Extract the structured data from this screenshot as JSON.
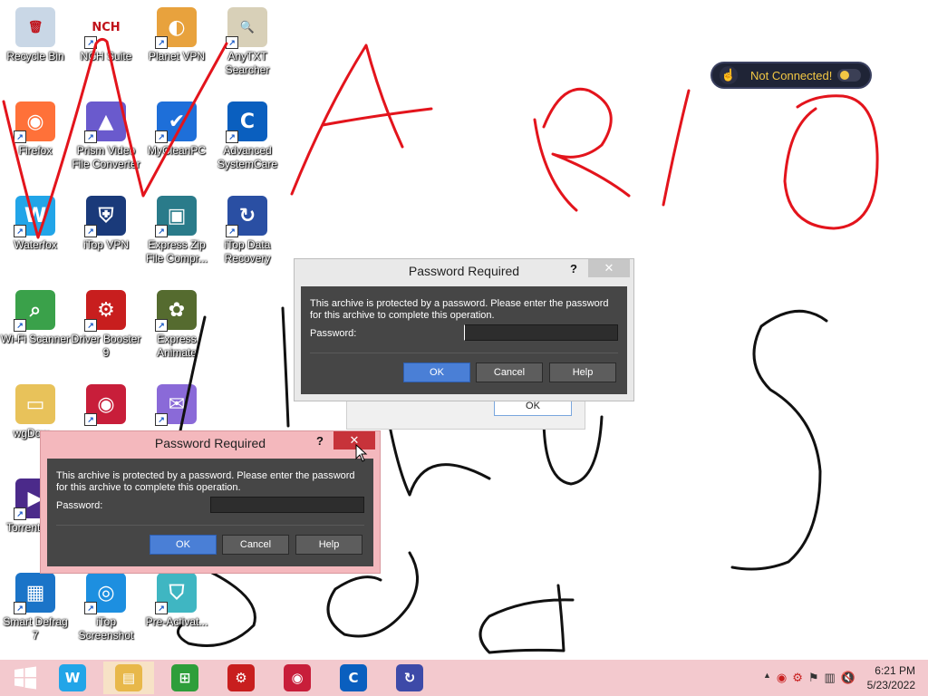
{
  "desktop_icons": [
    {
      "label": "Recycle Bin",
      "icon": "recycle-bin-icon",
      "color": "#c9d7e6",
      "glyph": "🗑",
      "shortcut": false
    },
    {
      "label": "NCH Suite",
      "icon": "nch-suite-icon",
      "color": "#ffffff",
      "glyph": "NCH",
      "shortcut": true
    },
    {
      "label": "Planet VPN",
      "icon": "planet-vpn-icon",
      "color": "#e8a23d",
      "glyph": "◐",
      "shortcut": true
    },
    {
      "label": "AnyTXT Searcher",
      "icon": "anytxt-searcher-icon",
      "color": "#d8d0b8",
      "glyph": "🔍",
      "shortcut": true
    },
    {
      "label": "Firefox",
      "icon": "firefox-icon",
      "color": "#ff7139",
      "glyph": "◉",
      "shortcut": true
    },
    {
      "label": "Prism Video File Converter",
      "icon": "prism-video-converter-icon",
      "color": "#6a5acd",
      "glyph": "▲",
      "shortcut": true
    },
    {
      "label": "MyCleanPC",
      "icon": "mycleanpc-icon",
      "color": "#1e6fd9",
      "glyph": "✔",
      "shortcut": true
    },
    {
      "label": "Advanced SystemCare",
      "icon": "advanced-systemcare-icon",
      "color": "#0a5fbf",
      "glyph": "C",
      "shortcut": true
    },
    {
      "label": "Waterfox",
      "icon": "waterfox-icon",
      "color": "#22a5e8",
      "glyph": "W",
      "shortcut": true
    },
    {
      "label": "iTop VPN",
      "icon": "itop-vpn-icon",
      "color": "#1a3a7a",
      "glyph": "⛨",
      "shortcut": true
    },
    {
      "label": "Express Zip File Compr...",
      "icon": "express-zip-icon",
      "color": "#2a7b8a",
      "glyph": "▣",
      "shortcut": true
    },
    {
      "label": "iTop Data Recovery",
      "icon": "itop-data-recovery-icon",
      "color": "#2a4fa3",
      "glyph": "↻",
      "shortcut": true
    },
    {
      "label": "Wi-Fi Scanner",
      "icon": "wifi-scanner-icon",
      "color": "#3aa14a",
      "glyph": "⌕",
      "shortcut": true
    },
    {
      "label": "Driver Booster 9",
      "icon": "driver-booster-icon",
      "color": "#c81e1e",
      "glyph": "⚙",
      "shortcut": true
    },
    {
      "label": "Express Animate",
      "icon": "express-animate-icon",
      "color": "#556b2f",
      "glyph": "✿",
      "shortcut": true
    },
    {
      "label": "wgDow...",
      "icon": "folder-icon",
      "color": "#e8c25a",
      "glyph": "▭",
      "shortcut": false
    },
    {
      "label": "",
      "icon": "itop-screen-recorder-icon",
      "color": "#c81e3a",
      "glyph": "◉",
      "shortcut": true
    },
    {
      "label": "",
      "icon": "mail-app-icon",
      "color": "#8a6ad8",
      "glyph": "✉",
      "shortcut": true
    },
    {
      "label": "Torrent Play",
      "icon": "torrent-player-icon",
      "color": "#4b2a8a",
      "glyph": "▶",
      "shortcut": true
    },
    {
      "label": "Smart Defrag 7",
      "icon": "smart-defrag-icon",
      "color": "#1b74c8",
      "glyph": "▦",
      "shortcut": true
    },
    {
      "label": "iTop Screenshot",
      "icon": "itop-screenshot-icon",
      "color": "#1d8fe0",
      "glyph": "◎",
      "shortcut": true
    },
    {
      "label": "Pre-Activat...",
      "icon": "pre-activation-icon",
      "color": "#3fb6c2",
      "glyph": "⛉",
      "shortcut": true
    }
  ],
  "vpn_widget": {
    "status": "Not Connected!",
    "accent": "#f2c744"
  },
  "dialog_back": {
    "title": "Password Required",
    "help_mark": "?",
    "close_glyph": "✕",
    "message": "This archive is protected by a password.  Please enter the password for this archive to complete this operation.",
    "password_label": "Password:",
    "password_value": "",
    "ok": "OK",
    "cancel": "Cancel",
    "help": "Help"
  },
  "dialog_front": {
    "title": "Password Required",
    "help_mark": "?",
    "close_glyph": "✕",
    "message": "This archive is protected by a password.  Please enter the password for this archive to complete this operation.",
    "password_label": "Password:",
    "password_value": "",
    "ok": "OK",
    "cancel": "Cancel",
    "help": "Help"
  },
  "ghost_dialog": {
    "ok": "OK"
  },
  "taskbar": {
    "start_icon": "windows-start-icon",
    "pinned": [
      {
        "icon": "waterfox-taskbar-icon",
        "glyph": "W",
        "color": "#22a5e8"
      },
      {
        "icon": "file-explorer-icon",
        "glyph": "▤",
        "color": "#e8b84a"
      },
      {
        "icon": "store-icon",
        "glyph": "⊞",
        "color": "#2e9e3a"
      },
      {
        "icon": "driver-booster-taskbar-icon",
        "glyph": "⚙",
        "color": "#c81e1e"
      },
      {
        "icon": "screen-recorder-taskbar-icon",
        "glyph": "◉",
        "color": "#c81e3a"
      },
      {
        "icon": "advanced-systemcare-taskbar-icon",
        "glyph": "C",
        "color": "#0a5fbf"
      },
      {
        "icon": "itop-data-recovery-taskbar-icon",
        "glyph": "↻",
        "color": "#3d4aa8"
      }
    ],
    "tray_icons": [
      "chevron-up-icon",
      "screen-recorder-tray-icon",
      "driver-booster-tray-icon",
      "flag-icon",
      "network-icon",
      "volume-muted-icon"
    ],
    "time": "6:21 PM",
    "date": "5/23/2022"
  }
}
